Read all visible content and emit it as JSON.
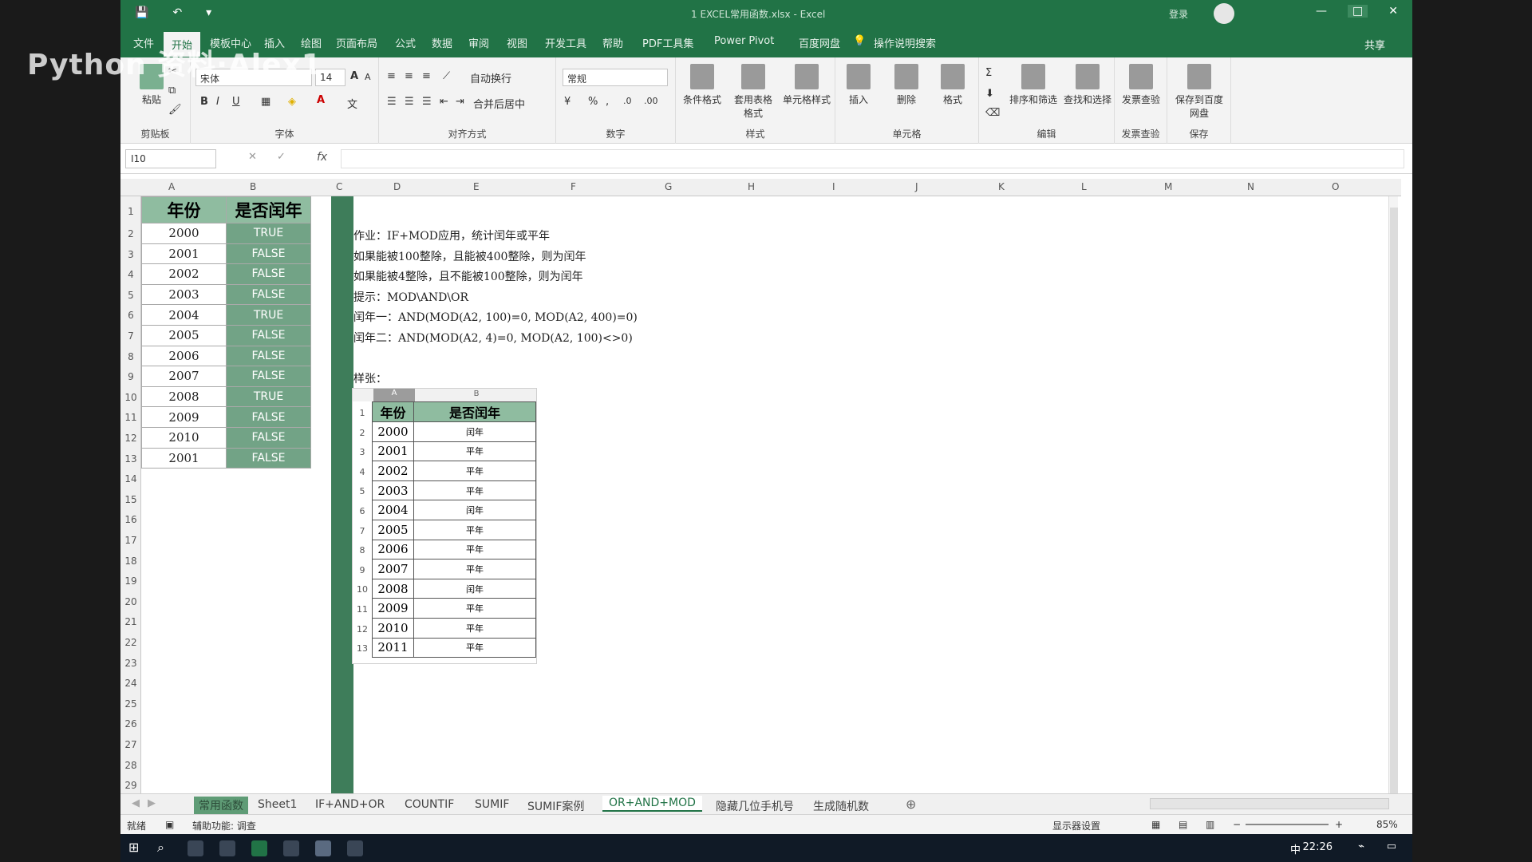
{
  "watermark": "Python 资料·Alex1",
  "window": {
    "title": "1 EXCEL常用函数.xlsx - Excel",
    "user": "登录",
    "controls": [
      "—",
      "□",
      "✕"
    ]
  },
  "qat": {
    "save": "💾",
    "undo": "↶",
    "customize": "▾"
  },
  "ribbon_tabs": [
    "文件",
    "开始",
    "模板中心",
    "插入",
    "绘图",
    "页面布局",
    "公式",
    "数据",
    "审阅",
    "视图",
    "开发工具",
    "帮助",
    "PDF工具集",
    "Power Pivot",
    "百度网盘"
  ],
  "active_tab": "开始",
  "tell_me": "操作说明搜索",
  "share": "共享",
  "ribbon": {
    "clipboard": {
      "label": "剪贴板",
      "paste": "粘贴"
    },
    "font": {
      "label": "字体",
      "name": "宋体",
      "size": "14"
    },
    "align": {
      "label": "对齐方式",
      "wrap": "自动换行",
      "merge": "合并后居中"
    },
    "number": {
      "label": "数字",
      "format": "常规"
    },
    "styles": {
      "label": "样式",
      "cond": "条件格式",
      "table": "套用表格格式",
      "cell": "单元格样式"
    },
    "cells": {
      "label": "单元格",
      "insert": "插入",
      "delete": "删除",
      "format": "格式"
    },
    "editing": {
      "label": "编辑",
      "sort": "排序和筛选",
      "find": "查找和选择"
    },
    "invoice": {
      "label": "发票查验",
      "btn": "发票查验"
    },
    "save": {
      "label": "保存",
      "btn": "保存到百度网盘"
    }
  },
  "formula_bar": {
    "name_box": "I10",
    "fx": "fx",
    "value": ""
  },
  "columns": [
    "A",
    "B",
    "C",
    "D",
    "E",
    "F",
    "G",
    "H",
    "I",
    "J",
    "K",
    "L",
    "M",
    "N",
    "O"
  ],
  "rows": [
    "1",
    "2",
    "3",
    "4",
    "5",
    "6",
    "7",
    "8",
    "9",
    "10",
    "11",
    "12",
    "13",
    "14",
    "15",
    "16",
    "17",
    "18",
    "19",
    "20",
    "21",
    "22",
    "23",
    "24",
    "25",
    "26",
    "27",
    "28",
    "29"
  ],
  "main_table": {
    "headers": [
      "年份",
      "是否闰年"
    ],
    "rows": [
      [
        "2000",
        "TRUE"
      ],
      [
        "2001",
        "FALSE"
      ],
      [
        "2002",
        "FALSE"
      ],
      [
        "2003",
        "FALSE"
      ],
      [
        "2004",
        "TRUE"
      ],
      [
        "2005",
        "FALSE"
      ],
      [
        "2006",
        "FALSE"
      ],
      [
        "2007",
        "FALSE"
      ],
      [
        "2008",
        "TRUE"
      ],
      [
        "2009",
        "FALSE"
      ],
      [
        "2010",
        "FALSE"
      ],
      [
        "2001",
        "FALSE"
      ]
    ]
  },
  "notes": [
    "作业：IF+MOD应用，统计闰年或平年",
    "如果能被100整除，且能被400整除，则为闰年",
    "如果能被4整除，且不能被100整除，则为闰年",
    "提示：MOD\\AND\\OR",
    "闰年一：AND(MOD(A2, 100)=0, MOD(A2, 400)=0)",
    "闰年二：AND(MOD(A2, 4)=0, MOD(A2, 100)<>0)",
    "",
    "样张："
  ],
  "sample": {
    "col_a": "A",
    "col_b": "B",
    "headers": [
      "年份",
      "是否闰年"
    ],
    "rows": [
      [
        "2000",
        "闰年"
      ],
      [
        "2001",
        "平年"
      ],
      [
        "2002",
        "平年"
      ],
      [
        "2003",
        "平年"
      ],
      [
        "2004",
        "闰年"
      ],
      [
        "2005",
        "平年"
      ],
      [
        "2006",
        "平年"
      ],
      [
        "2007",
        "平年"
      ],
      [
        "2008",
        "闰年"
      ],
      [
        "2009",
        "平年"
      ],
      [
        "2010",
        "平年"
      ],
      [
        "2011",
        "平年"
      ]
    ],
    "row_numbers": [
      "1",
      "2",
      "3",
      "4",
      "5",
      "6",
      "7",
      "8",
      "9",
      "10",
      "11",
      "12",
      "13"
    ]
  },
  "sheet_tabs": [
    "常用函数",
    "Sheet1",
    "IF+AND+OR",
    "COUNTIF",
    "SUMIF",
    "SUMIF案例",
    "OR+AND+MOD",
    "隐藏几位手机号",
    "生成随机数"
  ],
  "active_sheet": "OR+AND+MOD",
  "status": {
    "ready": "就绪",
    "accessibility": "辅助功能: 调查",
    "display": "显示器设置",
    "zoom": "85%"
  },
  "taskbar": {
    "ime": "中",
    "time": "22:26"
  }
}
